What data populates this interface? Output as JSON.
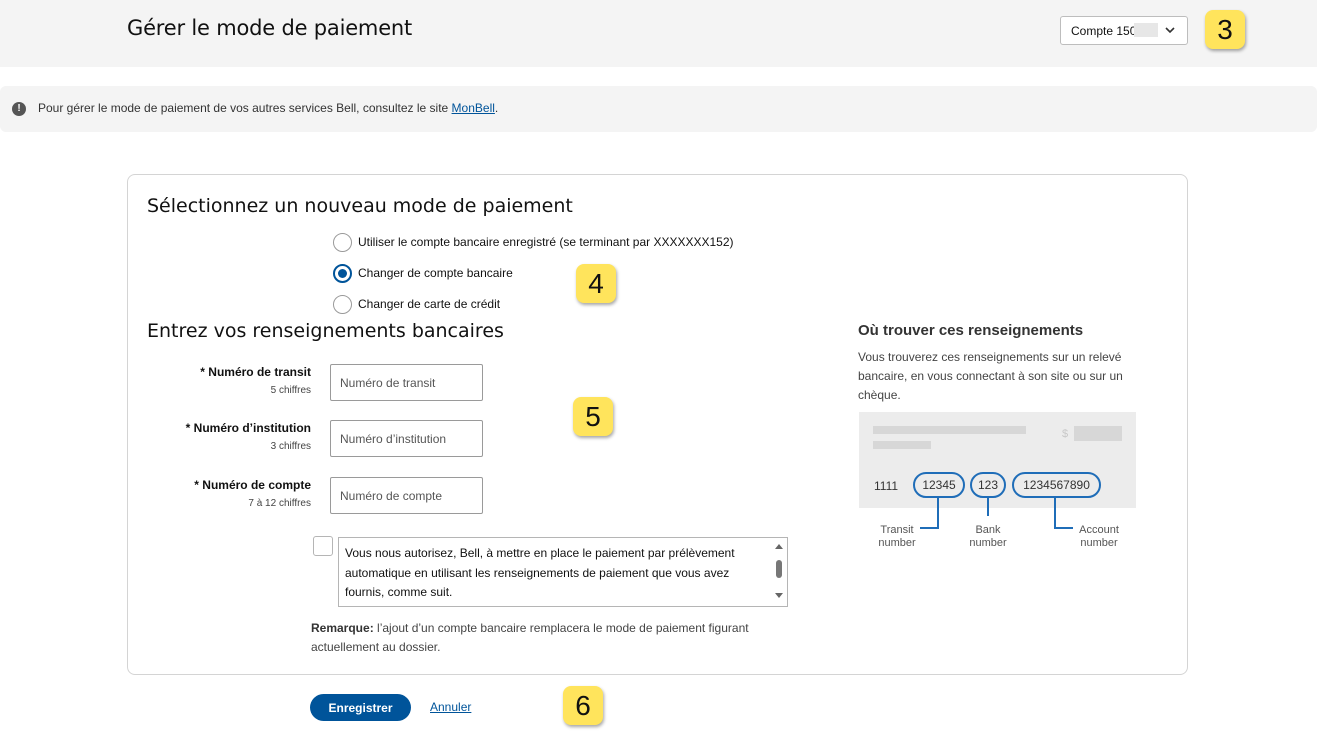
{
  "header": {
    "title": "Gérer le mode de paiement",
    "account_select": {
      "label": "Compte 150"
    },
    "badge": "3"
  },
  "notice": {
    "text": "Pour gérer le mode de paiement de vos autres services Bell, consultez le site ",
    "link": "MonBell",
    "end": "."
  },
  "payment_method": {
    "heading": "Sélectionnez un nouveau mode de paiement",
    "options": [
      {
        "label": "Utiliser le compte bancaire enregistré (se terminant par XXXXXXX152)",
        "selected": false
      },
      {
        "label": "Changer de compte bancaire",
        "selected": true
      },
      {
        "label": "Changer de carte de crédit",
        "selected": false
      }
    ],
    "badge": "4"
  },
  "bank_info": {
    "heading": "Entrez vos renseignements bancaires",
    "badge": "5",
    "fields": [
      {
        "label": "* Numéro de transit",
        "hint": "5 chiffres",
        "placeholder": "Numéro de transit",
        "value": ""
      },
      {
        "label": "* Numéro d’institution",
        "hint": "3 chiffres",
        "placeholder": "Numéro d’institution",
        "value": ""
      },
      {
        "label": "* Numéro de compte",
        "hint": "7 à 12 chiffres",
        "placeholder": "Numéro de compte",
        "value": ""
      }
    ],
    "terms_text": "Vous nous autorisez, Bell, à mettre en place le paiement par prélèvement automatique en utilisant les renseignements de paiement que vous avez fournis, comme suit.",
    "remark_label": "Remarque:",
    "remark_text": " l’ajout d’un compte bancaire remplacera le mode de paiement figurant actuellement au dossier."
  },
  "help": {
    "title": "Où trouver ces renseignements",
    "text": "Vous trouverez ces renseignements sur un relevé bancaire, en vous connectant à son site ou sur un chèque.",
    "cheque": {
      "dollar": "$",
      "prefix": "1111",
      "transit": "12345",
      "bank": "123",
      "account": "1234567890",
      "transit_caption_1": "Transit",
      "transit_caption_2": "number",
      "bank_caption_1": "Bank",
      "bank_caption_2": "number",
      "account_caption_1": "Account",
      "account_caption_2": "number"
    }
  },
  "actions": {
    "save": "Enregistrer",
    "cancel": "Annuler",
    "badge": "6"
  },
  "colors": {
    "accent": "#00549a",
    "badge": "#ffe45c",
    "cheque_outline": "#1f6db8"
  },
  "icons": {
    "notice": "info-circle-icon",
    "select": "chevron-down-icon"
  }
}
